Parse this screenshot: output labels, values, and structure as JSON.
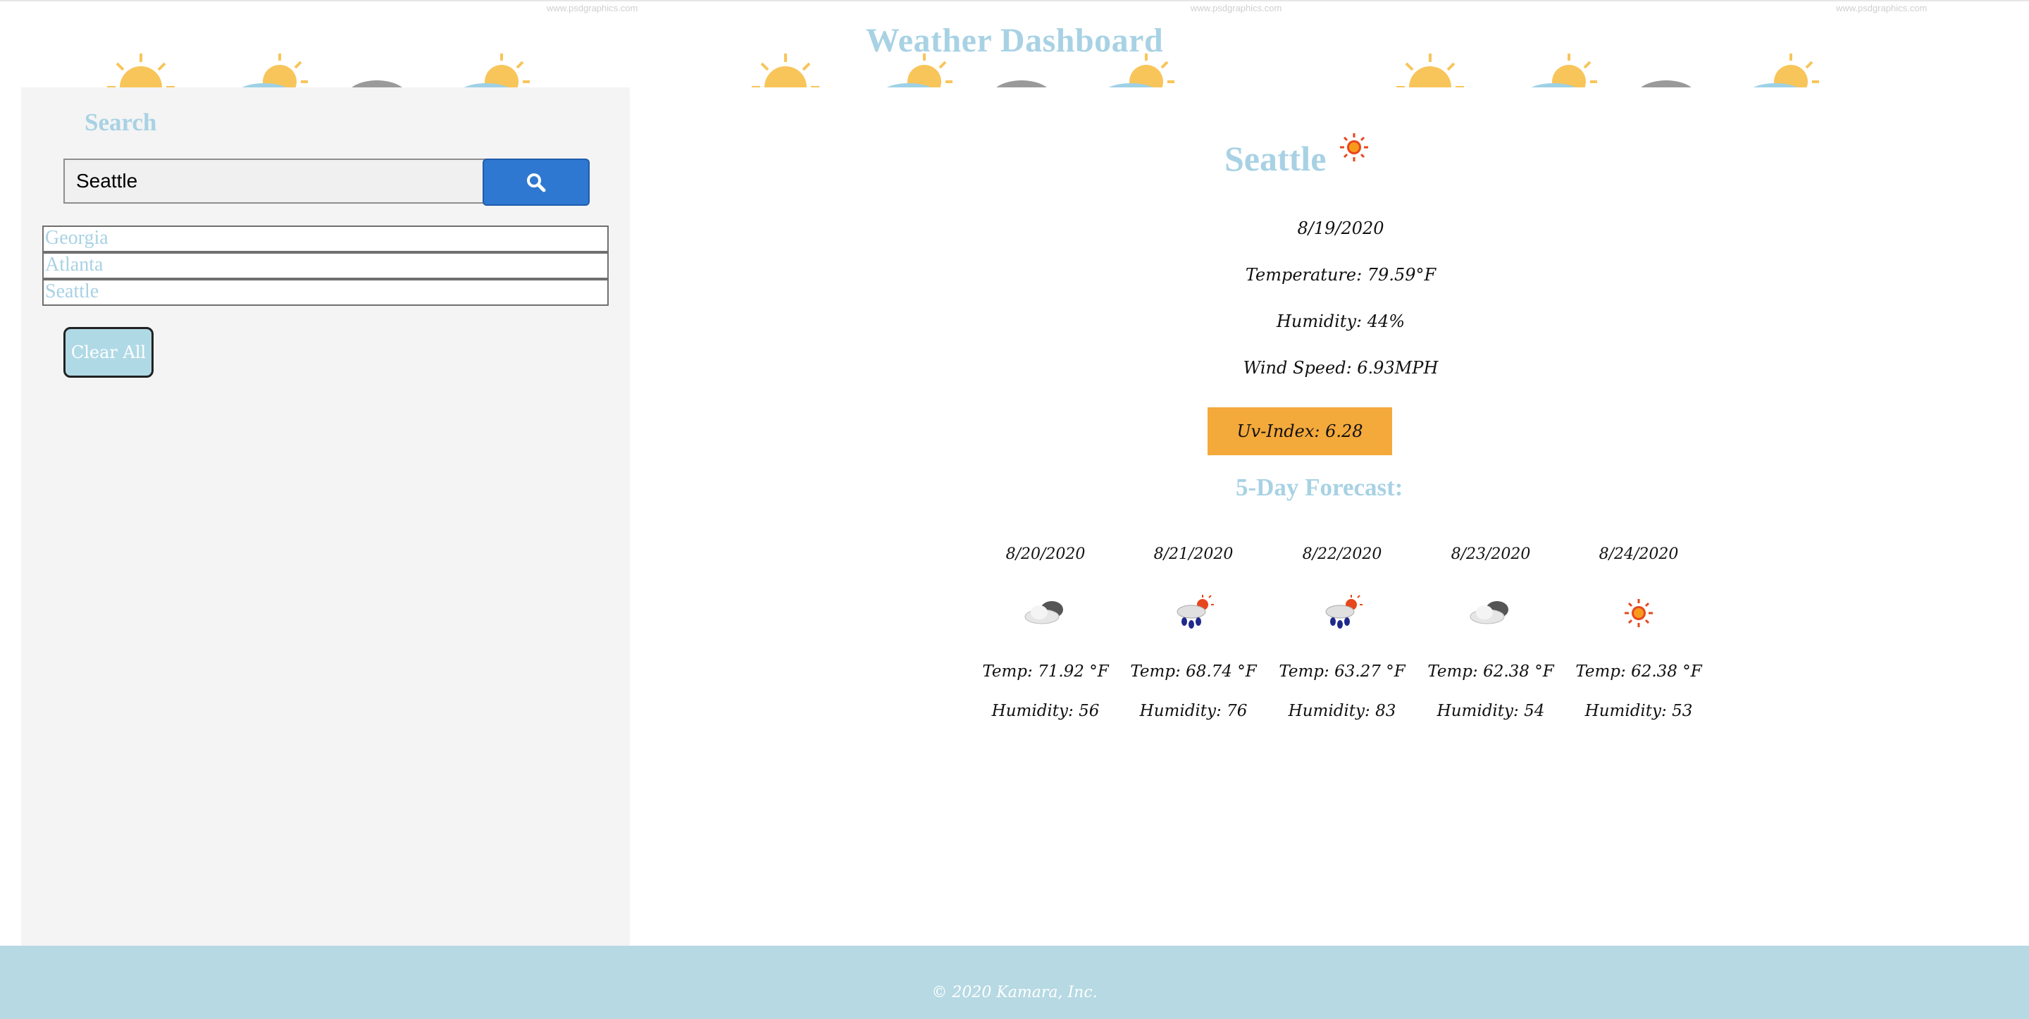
{
  "header": {
    "title": "Weather Dashboard",
    "watermark": "www.psdgraphics.com"
  },
  "sidebar": {
    "heading": "Search",
    "search_value": "Seattle",
    "search_button_icon": "search-icon",
    "history": [
      "Georgia",
      "Atlanta",
      "Seattle"
    ],
    "clear_label": "Clear All"
  },
  "current": {
    "city": "Seattle",
    "icon": "sun-icon",
    "date": "8/19/2020",
    "temperature": "Temperature: 79.59°F",
    "humidity": "Humidity: 44%",
    "wind": "Wind Speed: 6.93MPH",
    "uv": "Uv-Index: 6.28",
    "uv_color": "#f4a93b"
  },
  "forecast": {
    "heading": "5-Day Forecast:",
    "days": [
      {
        "date": "8/20/2020",
        "icon": "cloud-icon",
        "temp": "Temp: 71.92 °F",
        "humidity": "Humidity: 56"
      },
      {
        "date": "8/21/2020",
        "icon": "rain-sun-icon",
        "temp": "Temp: 68.74 °F",
        "humidity": "Humidity: 76"
      },
      {
        "date": "8/22/2020",
        "icon": "rain-sun-icon",
        "temp": "Temp: 63.27 °F",
        "humidity": "Humidity: 83"
      },
      {
        "date": "8/23/2020",
        "icon": "cloud-icon",
        "temp": "Temp: 62.38 °F",
        "humidity": "Humidity: 54"
      },
      {
        "date": "8/24/2020",
        "icon": "sun-icon",
        "temp": "Temp: 62.38 °F",
        "humidity": "Humidity: 53"
      }
    ]
  },
  "footer": {
    "text": "© 2020 Kamara, Inc."
  },
  "colors": {
    "accent": "#a8d2e4",
    "search_button": "#2f78d2",
    "footer": "#b6d9e3"
  }
}
